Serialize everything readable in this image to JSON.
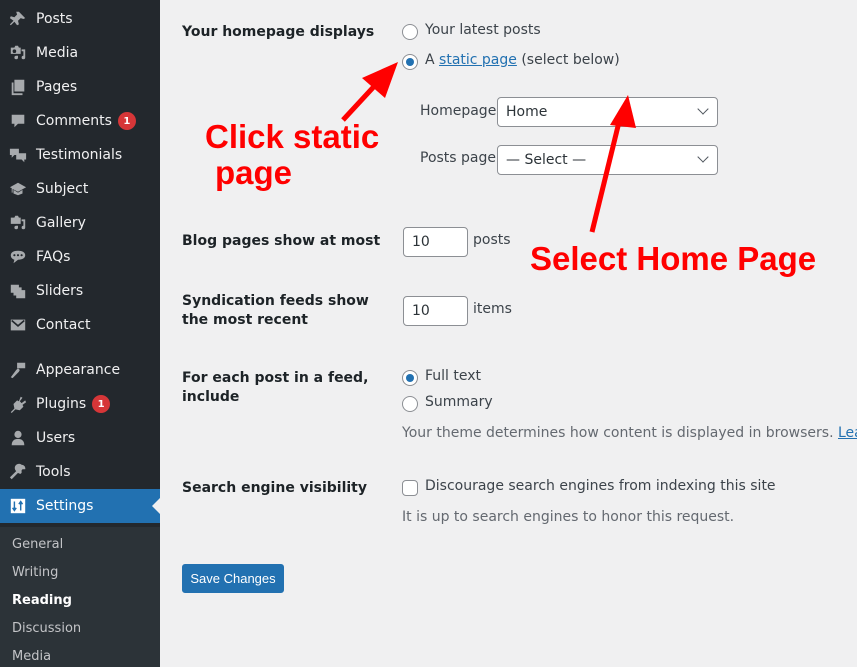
{
  "sidebar": {
    "items": [
      {
        "label": "Posts",
        "icon": "pin-icon"
      },
      {
        "label": "Media",
        "icon": "media-icon"
      },
      {
        "label": "Pages",
        "icon": "pages-icon"
      },
      {
        "label": "Comments",
        "icon": "comment-icon",
        "badge": "1"
      },
      {
        "label": "Testimonials",
        "icon": "testimonials-icon"
      },
      {
        "label": "Subject",
        "icon": "graduation-cap-icon"
      },
      {
        "label": "Gallery",
        "icon": "gallery-icon"
      },
      {
        "label": "FAQs",
        "icon": "faq-bubble-icon"
      },
      {
        "label": "Sliders",
        "icon": "sliders-icon"
      },
      {
        "label": "Contact",
        "icon": "envelope-icon"
      },
      {
        "label": "Appearance",
        "icon": "paintbrush-icon"
      },
      {
        "label": "Plugins",
        "icon": "plug-icon",
        "badge": "1"
      },
      {
        "label": "Users",
        "icon": "user-icon"
      },
      {
        "label": "Tools",
        "icon": "wrench-icon"
      },
      {
        "label": "Settings",
        "icon": "settings-icon",
        "active": true
      }
    ],
    "submenu": [
      {
        "label": "General"
      },
      {
        "label": "Writing"
      },
      {
        "label": "Reading",
        "current": true
      },
      {
        "label": "Discussion"
      },
      {
        "label": "Media"
      }
    ]
  },
  "main": {
    "homepage_displays": {
      "label": "Your homepage displays",
      "option_latest": "Your latest posts",
      "option_static_prefix": "A",
      "option_static_link": "static page",
      "option_static_suffix": "(select below)",
      "selected": "static",
      "homepage_label": "Homepage:",
      "homepage_value": "Home",
      "posts_page_label": "Posts page:",
      "posts_page_value": "— Select —"
    },
    "blog_pages": {
      "label": "Blog pages show at most",
      "value": "10",
      "unit": "posts"
    },
    "syndication": {
      "label": "Syndication feeds show the most recent",
      "value": "10",
      "unit": "items"
    },
    "feed_include": {
      "label": "For each post in a feed, include",
      "option_full": "Full text",
      "option_summary": "Summary",
      "selected": "full",
      "description": "Your theme determines how content is displayed in browsers.",
      "learn_more": "Learn more"
    },
    "search_visibility": {
      "label": "Search engine visibility",
      "checkbox_label": "Discourage search engines from indexing this site",
      "checked": false,
      "description": "It is up to search engines to honor this request."
    },
    "save_label": "Save Changes"
  },
  "annotations": {
    "click_static_line1": "Click static",
    "click_static_line2": "page",
    "select_home": "Select Home Page",
    "color": "#ff0000"
  }
}
